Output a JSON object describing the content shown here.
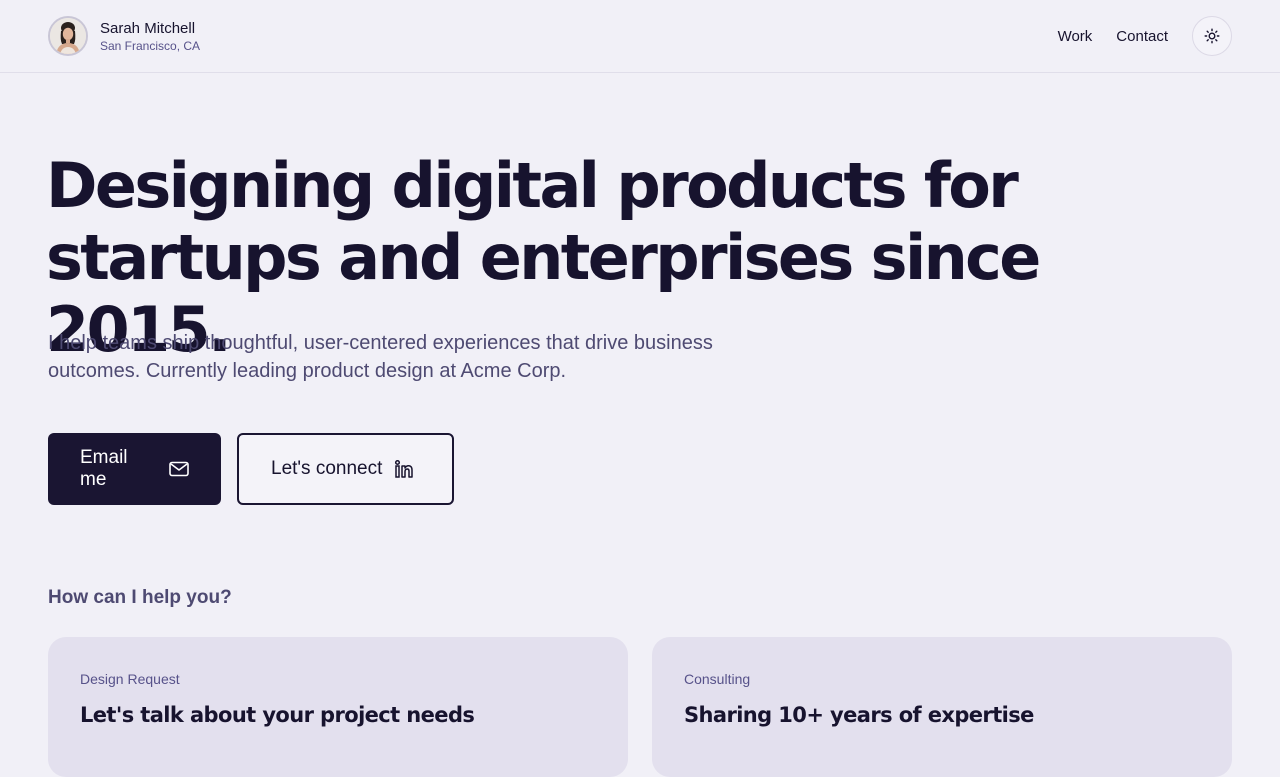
{
  "profile": {
    "name": "Sarah Mitchell",
    "location": "San Francisco, CA"
  },
  "nav": {
    "links": [
      "Work",
      "Contact"
    ],
    "theme_icon": "sun-icon"
  },
  "hero": {
    "title": "Designing digital products for startups and enterprises since 2015.",
    "subtitle": "I help teams ship thoughtful, user-centered experiences that drive business outcomes. Currently leading product design at Acme Corp."
  },
  "buttons": {
    "email_label": "Email me",
    "email_icon": "mail-icon",
    "connect_label": "Let's connect",
    "connect_icon": "linkedin-icon"
  },
  "services": {
    "heading": "How can I help you?",
    "cards": [
      {
        "tag": "Design Request",
        "title": "Let's talk about your project needs"
      },
      {
        "tag": "Consulting",
        "title": "Sharing 10+ years of expertise"
      }
    ]
  },
  "colors": {
    "background": "#f1f0f7",
    "primary": "#1a1532",
    "muted_text": "#4e4a72",
    "card": "#e3e0ee"
  }
}
